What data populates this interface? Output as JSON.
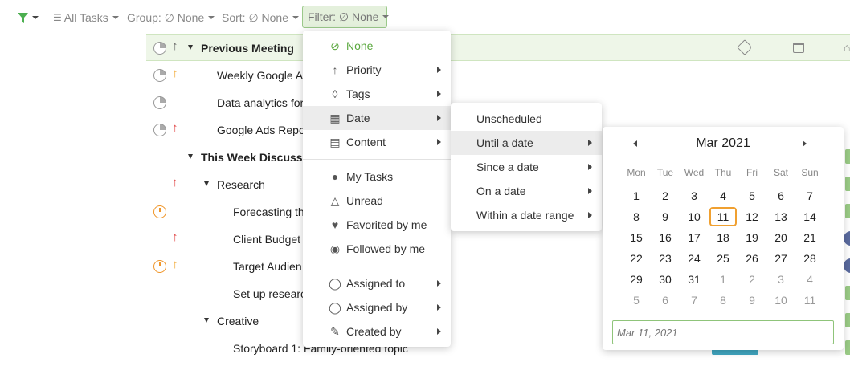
{
  "toolbar": {
    "filter_icon": "funnel-icon",
    "view_label": "All Tasks",
    "group_label": "Group: ∅ None",
    "sort_label": "Sort: ∅ None",
    "filter_label": "Filter: ∅ None"
  },
  "colors": {
    "accent": "#5aa83e",
    "group_bg": "#eef6e8",
    "today_ring": "#f0a030",
    "priority_high": "#e04545",
    "priority_med": "#f0a020"
  },
  "tasks": [
    {
      "label": "Previous Meeting",
      "kind": "group",
      "priority_icon": "arrow-up-icon"
    },
    {
      "label": "Weekly Google A",
      "priority_icon": "arrow-up-icon"
    },
    {
      "label": "Data analytics for"
    },
    {
      "label": "Google Ads Repo",
      "priority_icon": "arrow-up-icon"
    },
    {
      "label": "This Week Discussio",
      "kind": "group"
    },
    {
      "label": "Research",
      "kind": "subgroup"
    },
    {
      "label": "Forecasting th"
    },
    {
      "label": "Client Budget"
    },
    {
      "label": "Target Audien"
    },
    {
      "label": "Set up researc"
    },
    {
      "label": "Creative",
      "kind": "subgroup"
    },
    {
      "label": "Storyboard 1: Family-oriented topic"
    }
  ],
  "filter_menu": {
    "none": "None",
    "priority": "Priority",
    "tags": "Tags",
    "date": "Date",
    "content": "Content",
    "my_tasks": "My Tasks",
    "unread": "Unread",
    "favorited": "Favorited by me",
    "followed": "Followed by me",
    "assigned_to": "Assigned to",
    "assigned_by": "Assigned by",
    "created_by": "Created by"
  },
  "date_menu": {
    "unscheduled": "Unscheduled",
    "until": "Until a date",
    "since": "Since a date",
    "on": "On a date",
    "range": "Within a date range"
  },
  "calendar": {
    "month": "Mar 2021",
    "weekdays": [
      "Mon",
      "Tue",
      "Wed",
      "Thu",
      "Fri",
      "Sat",
      "Sun"
    ],
    "weeks": [
      [
        "1",
        "2",
        "3",
        "4",
        "5",
        "6",
        "7"
      ],
      [
        "8",
        "9",
        "10",
        "11",
        "12",
        "13",
        "14"
      ],
      [
        "15",
        "16",
        "17",
        "18",
        "19",
        "20",
        "21"
      ],
      [
        "22",
        "23",
        "24",
        "25",
        "26",
        "27",
        "28"
      ],
      [
        "29",
        "30",
        "31",
        "1",
        "2",
        "3",
        "4"
      ],
      [
        "5",
        "6",
        "7",
        "8",
        "9",
        "10",
        "11"
      ]
    ],
    "today": "11",
    "input_placeholder": "Mar 11, 2021"
  }
}
